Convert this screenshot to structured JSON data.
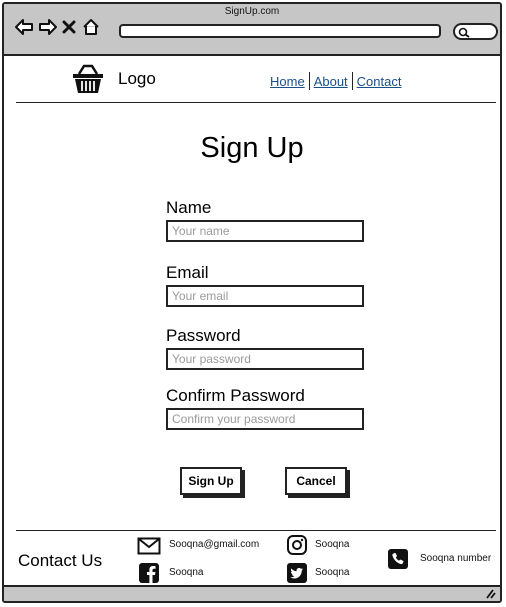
{
  "browser": {
    "title": "SignUp.com"
  },
  "header": {
    "logo_text": "Logo",
    "nav": [
      {
        "label": "Home"
      },
      {
        "label": "About"
      },
      {
        "label": "Contact"
      }
    ]
  },
  "form": {
    "title": "Sign Up",
    "fields": [
      {
        "label": "Name",
        "placeholder": "Your name"
      },
      {
        "label": "Email",
        "placeholder": "Your email"
      },
      {
        "label": "Password",
        "placeholder": "Your password"
      },
      {
        "label": "Confirm Password",
        "placeholder": "Confirm your password"
      }
    ],
    "submit_label": "Sign Up",
    "cancel_label": "Cancel"
  },
  "footer": {
    "contact_title": "Contact Us",
    "email": {
      "icon": "mail-icon",
      "text": "Sooqna@gmail.com"
    },
    "facebook": {
      "icon": "facebook-icon",
      "text": "Sooqna"
    },
    "instagram": {
      "icon": "instagram-icon",
      "text": "Sooqna"
    },
    "twitter": {
      "icon": "twitter-icon",
      "text": "Sooqna"
    },
    "phone": {
      "icon": "phone-icon",
      "text": "Sooqna number"
    }
  },
  "colors": {
    "chrome": "#c6c6c6",
    "link": "#1a4f8a",
    "border": "#222222"
  }
}
